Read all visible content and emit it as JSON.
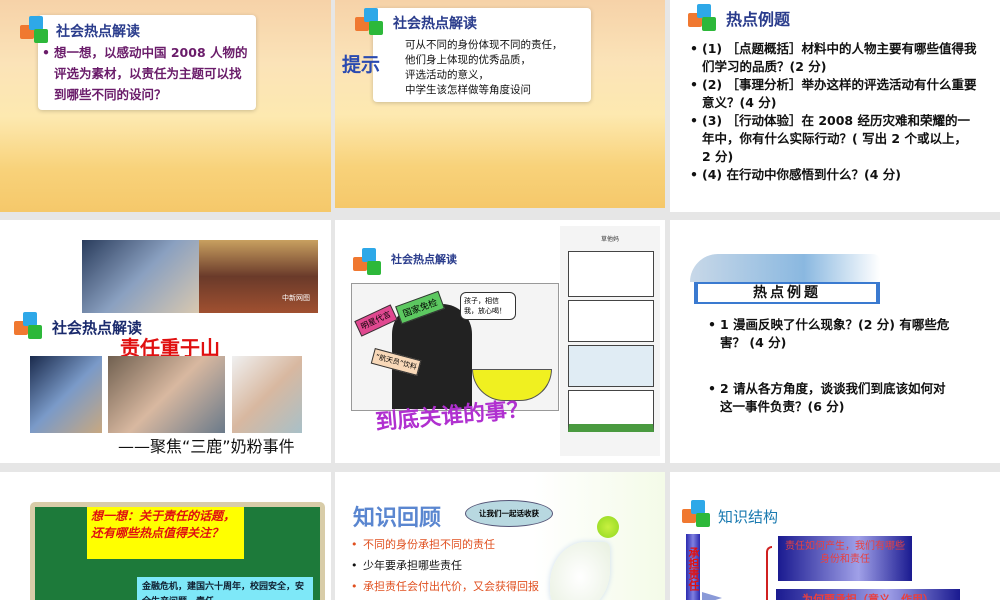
{
  "slides": [
    {
      "title": "社会热点解读",
      "body": "想一想，以感动中国 2008 人物的评选为素材，以责任为主题可以找到哪些不同的设问？"
    },
    {
      "title": "社会热点解读",
      "tag": "提示",
      "lines": [
        "可从不同的身份体现不同的责任，",
        "他们身上体现的优秀品质，",
        "评选活动的意义，",
        "中学生该怎样做等角度设问"
      ]
    },
    {
      "title": "热点例题",
      "items": [
        "(1) ［点题概括］材料中的人物主要有哪些值得我们学习的品质？(2 分)",
        "(2) ［事理分析］举办这样的评选活动有什么重要意义？(4 分)",
        "(3) ［行动体验］在 2008 经历灾难和荣耀的一年中，你有什么实际行动？( 写出 2 个或以上， 2 分)",
        "(4) 在行动中你感悟到什么？(4 分)"
      ]
    },
    {
      "title": "社会热点解读",
      "headline": "责任重于山",
      "subtitle": "——聚焦“三鹿”奶粉事件",
      "photo_caption": "中新网图"
    },
    {
      "title": "社会热点解读",
      "bubble": "孩子，相信我，放心喝！",
      "sign1": "国家免检",
      "sign2": "明星代言",
      "sign3": "“航天员”饮料",
      "caption": "到底关谁的事？",
      "strip_title": "草他妈"
    },
    {
      "banner": "热点例题",
      "items": [
        "1  漫画反映了什么现象？(2 分) 有哪些危害？  (4 分)",
        "2  请从各方角度，谈谈我们到底该如何对这一事件负责？(6 分)"
      ]
    },
    {
      "question": "想一想：关于责任的话题，还有哪些热点值得关注？",
      "topics": "金融危机，建国六十周年，校园安全，安全生产问题，责任..."
    },
    {
      "title": "知识回顾",
      "bubble": "让我们一起话收获",
      "items": [
        "不同的身份承担不同的责任",
        "少年要承担哪些责任",
        "承担责任会付出代价，又会获得回报"
      ]
    },
    {
      "title": "知识结构",
      "side": "承担责任",
      "box1": "责任如何产生，我们有哪些身份和责任",
      "box2": "为何要承担（意义、作用）"
    }
  ],
  "colors": {
    "accent": "#2a3c8c",
    "headline_red": "#e01010",
    "purple": "#a020c0"
  }
}
